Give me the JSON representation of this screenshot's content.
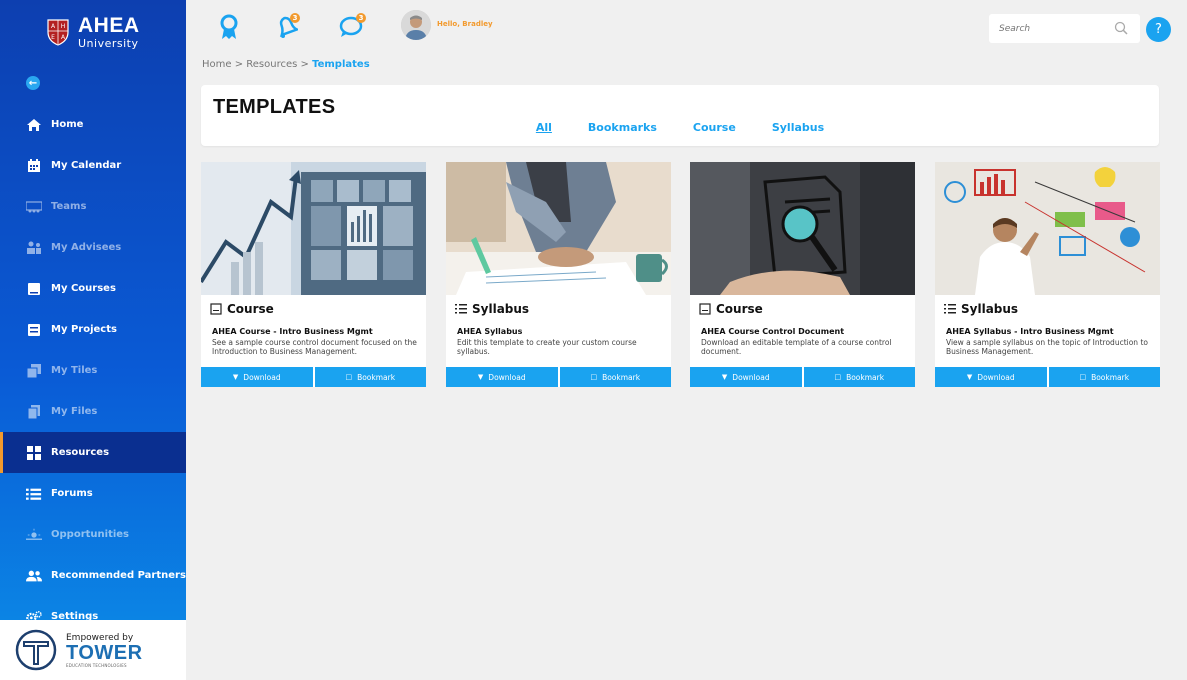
{
  "brand": {
    "name": "AHEA",
    "sub": "University",
    "shield_letters": [
      "A",
      "H",
      "E",
      "A"
    ]
  },
  "nav": [
    {
      "label": "Home",
      "icon": "home-icon",
      "state": "normal"
    },
    {
      "label": "My Calendar",
      "icon": "calendar-icon",
      "state": "normal"
    },
    {
      "label": "Teams",
      "icon": "teams-icon",
      "state": "dim"
    },
    {
      "label": "My Advisees",
      "icon": "advisees-icon",
      "state": "dim"
    },
    {
      "label": "My Courses",
      "icon": "book-icon",
      "state": "normal"
    },
    {
      "label": "My Projects",
      "icon": "projects-icon",
      "state": "normal"
    },
    {
      "label": "My Tiles",
      "icon": "tiles-icon",
      "state": "dim"
    },
    {
      "label": "My Files",
      "icon": "files-icon",
      "state": "dim"
    },
    {
      "label": "Resources",
      "icon": "grid-icon",
      "state": "active"
    },
    {
      "label": "Forums",
      "icon": "forums-icon",
      "state": "normal"
    },
    {
      "label": "Opportunities",
      "icon": "opportunities-icon",
      "state": "dim"
    },
    {
      "label": "Recommended Partners",
      "icon": "partners-icon",
      "state": "normal"
    },
    {
      "label": "Settings",
      "icon": "gear-icon",
      "state": "normal"
    }
  ],
  "powered": {
    "line1": "Empowered by",
    "brand": "TOWER",
    "tagline": "EDUCATION TECHNOLOGIES"
  },
  "topbar": {
    "notifications_count": "3",
    "messages_count": "3",
    "greeting": "Hello, Bradley",
    "search_placeholder": "Search",
    "help": "?"
  },
  "breadcrumb": {
    "home": "Home",
    "sep1": " > ",
    "resources": "Resources",
    "sep2": " > ",
    "current": "Templates"
  },
  "header": {
    "title": "TEMPLATES",
    "tabs": [
      {
        "label": "All",
        "active": true
      },
      {
        "label": "Bookmarks",
        "active": false
      },
      {
        "label": "Course",
        "active": false
      },
      {
        "label": "Syllabus",
        "active": false
      }
    ]
  },
  "cards": [
    {
      "type": "Course",
      "name": "AHEA Course - Intro Business Mgmt",
      "desc": "See a sample course control document focused on the Introduction to Business Management.",
      "download": "Download",
      "bookmark": "Bookmark"
    },
    {
      "type": "Syllabus",
      "name": "AHEA Syllabus",
      "desc": "Edit this template to create your custom course syllabus.",
      "download": "Download",
      "bookmark": "Bookmark"
    },
    {
      "type": "Course",
      "name": "AHEA Course Control Document",
      "desc": "Download an editable template of a course control document.",
      "download": "Download",
      "bookmark": "Bookmark"
    },
    {
      "type": "Syllabus",
      "name": "AHEA Syllabus - Intro Business Mgmt",
      "desc": "View a sample syllabus on the topic of Introduction to Business Management.",
      "download": "Download",
      "bookmark": "Bookmark"
    }
  ],
  "colors": {
    "accent": "#1aa3f0",
    "sidebar_top": "#0d3fb0",
    "sidebar_active": "#0a2f90",
    "orange": "#f29a2e"
  }
}
